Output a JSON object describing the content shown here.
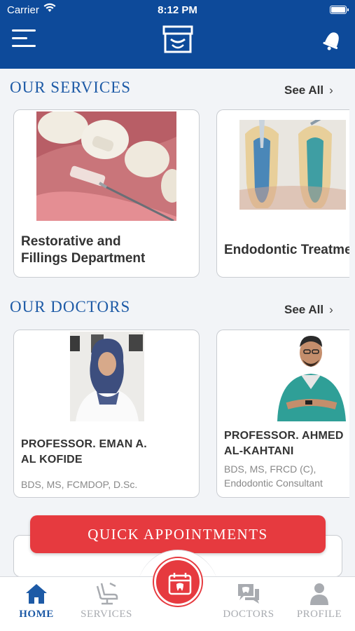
{
  "status_bar": {
    "carrier": "Carrier",
    "time": "8:12 PM"
  },
  "header": {
    "menu_icon": "hamburger-icon",
    "logo_icon": "dental-logo-icon",
    "notification_icon": "bell-icon"
  },
  "services": {
    "title": "OUR SERVICES",
    "see_all": "See All",
    "items": [
      {
        "title": "Restorative and\nFillings Department"
      },
      {
        "title": "Endodontic Treatment"
      }
    ]
  },
  "doctors": {
    "title": "OUR DOCTORS",
    "see_all": "See All",
    "items": [
      {
        "name": "PROFESSOR. EMAN A.\nAL KOFIDE",
        "qualifications": "BDS, MS, FCMDOP, D.Sc."
      },
      {
        "name": "PROFESSOR. AHMED\nAL-KAHTANI",
        "qualifications": "BDS, MS, FRCD (C),\nEndodontic Consultant"
      }
    ]
  },
  "quick_appointments": {
    "label": "QUICK APPOINTMENTS"
  },
  "tab_bar": {
    "tabs": [
      {
        "label": "HOME",
        "icon": "home-icon",
        "active": true
      },
      {
        "label": "SERVICES",
        "icon": "dental-chair-icon",
        "active": false
      },
      {
        "label": "DOCTORS",
        "icon": "doctors-chat-icon",
        "active": false
      },
      {
        "label": "PROFILE",
        "icon": "profile-icon",
        "active": false
      }
    ],
    "center_icon": "calendar-tooth-icon"
  },
  "colors": {
    "primary": "#0d4a9a",
    "accent": "#e63a3f",
    "section_title": "#1d5aa6"
  }
}
